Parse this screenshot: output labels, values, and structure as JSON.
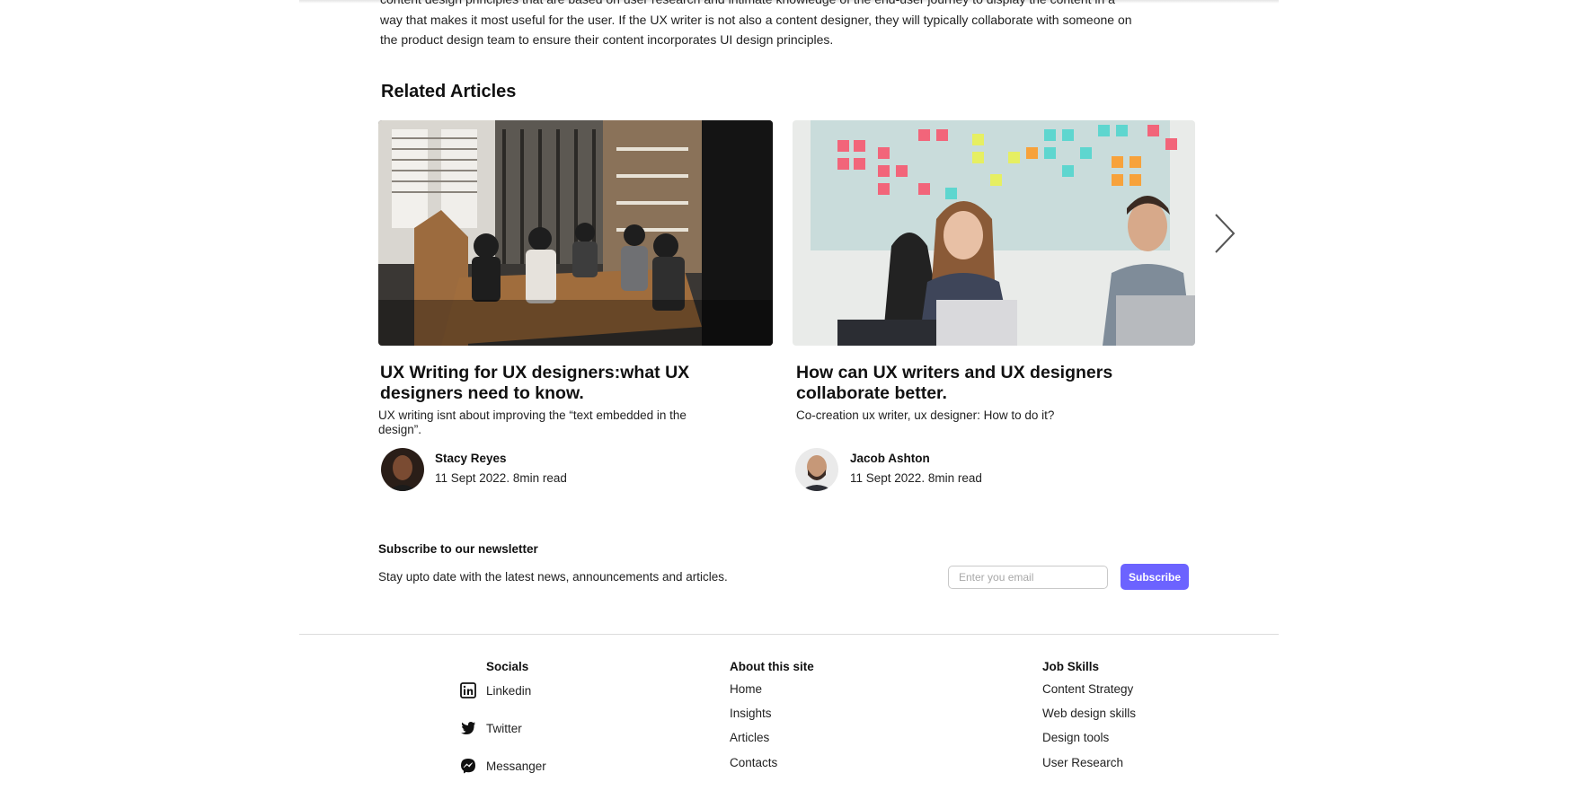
{
  "article": {
    "intro_line1": "content design principles that are based on user research and intimate knowledge of the end-user journey to display the content in a",
    "intro_line2": "way that makes it most useful for the user. If the UX writer is not also a content designer, they will typically collaborate with someone on",
    "intro_line3": "the product design team to ensure their content incorporates UI design principles."
  },
  "related": {
    "title": "Related Articles",
    "cards": [
      {
        "title": "UX Writing for UX designers:what UX designers need to know.",
        "description": "UX writing isnt about improving the “text embedded in the design”.",
        "author": "Stacy Reyes",
        "meta": "11 Sept 2022. 8min read"
      },
      {
        "title": "How can UX writers and UX designers collaborate better.",
        "description": "Co-creation ux writer, ux designer: How to do it?",
        "author": "Jacob Ashton",
        "meta": "11 Sept 2022. 8min read"
      }
    ]
  },
  "newsletter": {
    "title": "Subscribe to our newsletter",
    "description": "Stay upto date with the latest news, announcements and articles.",
    "input_placeholder": "Enter you email",
    "button_label": "Subscribe"
  },
  "footer": {
    "socials": {
      "heading": "Socials",
      "items": [
        {
          "label": "Linkedin",
          "icon": "linkedin-icon"
        },
        {
          "label": "Twitter",
          "icon": "twitter-icon"
        },
        {
          "label": "Messanger",
          "icon": "messenger-icon"
        }
      ]
    },
    "about": {
      "heading": "About this site",
      "items": [
        "Home",
        "Insights",
        "Articles",
        "Contacts"
      ]
    },
    "skills": {
      "heading": "Job Skills",
      "items": [
        "Content Strategy",
        "Web design skills",
        "Design tools",
        "User Research"
      ]
    }
  },
  "colors": {
    "accent": "#6c63ff",
    "text": "#111111",
    "divider": "#dcdcdc"
  }
}
